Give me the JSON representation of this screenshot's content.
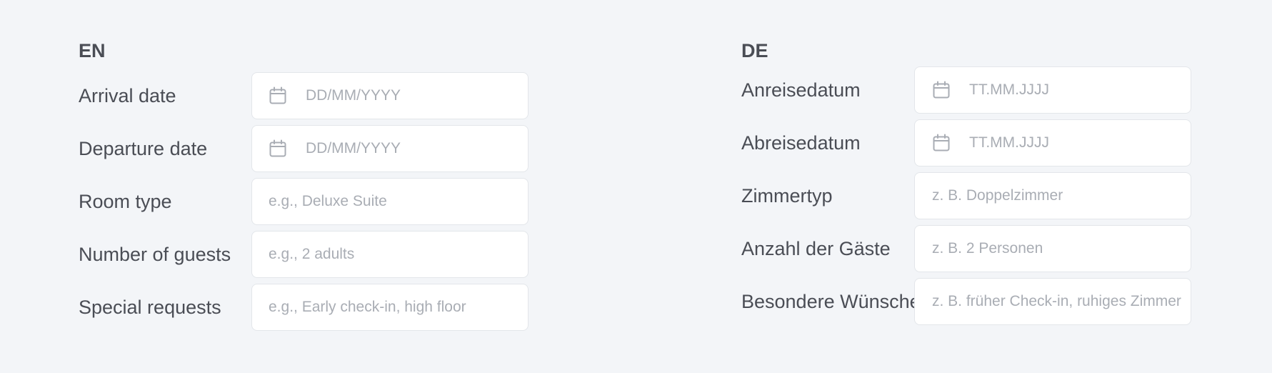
{
  "forms": [
    {
      "heading": "EN",
      "fields": [
        {
          "label": "Arrival date",
          "placeholder": "DD/MM/YYYY",
          "icon": "calendar-icon",
          "value": ""
        },
        {
          "label": "Departure date",
          "placeholder": "DD/MM/YYYY",
          "icon": "calendar-icon",
          "value": ""
        },
        {
          "label": "Room type",
          "placeholder": "e.g., Deluxe Suite",
          "icon": "",
          "value": ""
        },
        {
          "label": "Number of guests",
          "placeholder": "e.g., 2 adults",
          "icon": "",
          "value": ""
        },
        {
          "label": "Special requests",
          "placeholder": "e.g., Early check-in, high floor",
          "icon": "",
          "value": ""
        }
      ]
    },
    {
      "heading": "DE",
      "fields": [
        {
          "label": "Anreisedatum",
          "placeholder": "TT.MM.JJJJ",
          "icon": "calendar-icon",
          "value": ""
        },
        {
          "label": "Abreisedatum",
          "placeholder": "TT.MM.JJJJ",
          "icon": "calendar-icon",
          "value": ""
        },
        {
          "label": "Zimmertyp",
          "placeholder": "z. B. Doppelzimmer",
          "icon": "",
          "value": ""
        },
        {
          "label": "Anzahl der Gäste",
          "placeholder": "z. B. 2 Personen",
          "icon": "",
          "value": ""
        },
        {
          "label": "Besondere Wünsche",
          "placeholder": "z. B. früher Check-in, ruhiges Zimmer",
          "icon": "",
          "value": ""
        }
      ]
    }
  ],
  "colors": {
    "background": "#f3f5f8",
    "label_text": "#4a4d55",
    "placeholder_text": "#a9adb4",
    "input_border": "#e3e6ea",
    "icon": "#a9adb4"
  }
}
